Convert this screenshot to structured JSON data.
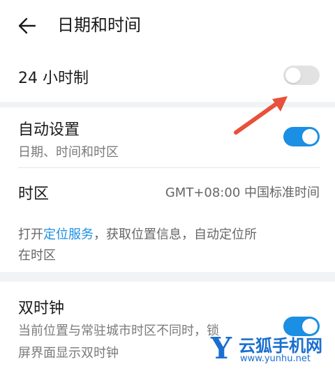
{
  "header": {
    "title": "日期和时间",
    "back_icon": "back-arrow-icon"
  },
  "hour24": {
    "label": "24 小时制",
    "enabled": false
  },
  "auto": {
    "title": "自动设置",
    "subtitle": "日期、时间和时区",
    "enabled": true
  },
  "timezone": {
    "label": "时区",
    "value": "GMT+08:00 中国标准时间"
  },
  "info": {
    "prefix": "打开",
    "link": "定位服务",
    "suffix_line1": "，获取位置信息，自动定位所",
    "line2": "在时区"
  },
  "dual_clock": {
    "title": "双时钟",
    "subtitle_line1": "当前位置与常驻城市时区不同时，锁",
    "subtitle_line2": "屏界面显示双时钟",
    "enabled": true
  },
  "watermark": {
    "brand_letter": "Y",
    "brand": "云狐手机网",
    "url": "www.yunhu.net"
  },
  "colors": {
    "accent": "#1a8fe3",
    "arrow": "#e8513a",
    "toggle_off": "#e2e2e2",
    "background": "#f1f3f5"
  }
}
